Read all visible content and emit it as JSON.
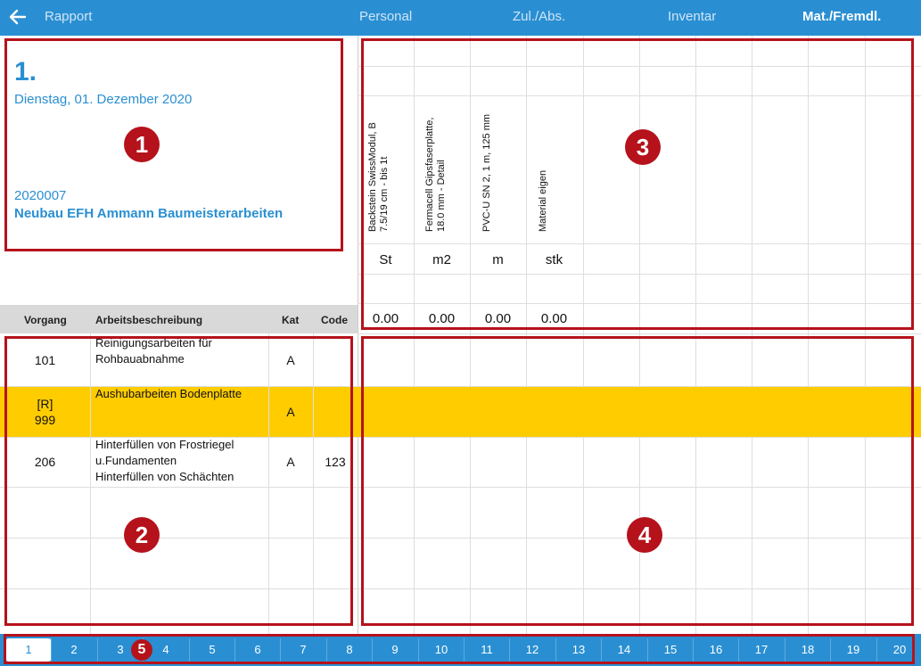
{
  "nav": {
    "back_label": "Rapport",
    "tabs": [
      {
        "label": "Personal",
        "active": false
      },
      {
        "label": "Zul./Abs.",
        "active": false
      },
      {
        "label": "Inventar",
        "active": false
      },
      {
        "label": "Mat./Fremdl.",
        "active": true
      }
    ]
  },
  "header": {
    "day_number": "1.",
    "date": "Dienstag, 01. Dezember 2020",
    "project_number": "2020007",
    "project_name": "Neubau EFH Ammann Baumeisterarbeiten"
  },
  "table": {
    "columns": [
      "Vorgang",
      "Arbeitsbeschreibung",
      "Kat",
      "Code"
    ],
    "rows": [
      {
        "vorgang": "101",
        "desc": "Reinigungsarbeiten für\nRohbauabnahme",
        "kat": "A",
        "code": "",
        "highlighted": false
      },
      {
        "vorgang": "[R]\n999",
        "desc": "Aushubarbeiten Bodenplatte",
        "kat": "A",
        "code": "",
        "highlighted": true
      },
      {
        "vorgang": "206",
        "desc": "Hinterfüllen von Frostriegel\nu.Fundamenten\nHinterfüllen von Schächten",
        "kat": "A",
        "code": "123",
        "highlighted": false
      }
    ]
  },
  "materials": [
    {
      "name": "Backstein SwissModul, B\n7.5/19 cm - bis 1t",
      "unit": "St",
      "total": "0.00"
    },
    {
      "name": "Fermacell Gipsfaserplatte,\n18.0 mm - Detail",
      "unit": "m2",
      "total": "0.00"
    },
    {
      "name": "PVC-U SN 2, 1 m, 125 mm",
      "unit": "m",
      "total": "0.00"
    },
    {
      "name": "Material eigen",
      "unit": "stk",
      "total": "0.00"
    }
  ],
  "callouts": [
    "1",
    "2",
    "3",
    "4",
    "5"
  ],
  "pagination": {
    "pages": [
      "1",
      "2",
      "3",
      "4",
      "5",
      "6",
      "7",
      "8",
      "9",
      "10",
      "11",
      "12",
      "13",
      "14",
      "15",
      "16",
      "17",
      "18",
      "19",
      "20"
    ],
    "selected": "1"
  },
  "colors": {
    "accent": "#2a8fd2",
    "highlight_row": "#ffcc00",
    "callout": "#b5121b"
  },
  "icons": {
    "back": "arrow-left-icon"
  }
}
